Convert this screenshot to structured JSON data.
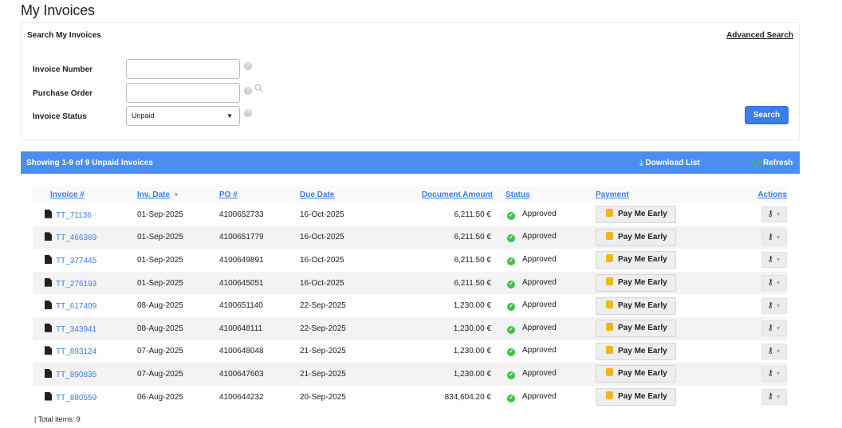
{
  "page": {
    "title": "My Invoices"
  },
  "search": {
    "heading": "Search My Invoices",
    "advanced_link": "Advanced Search",
    "invoice_number_label": "Invoice Number",
    "invoice_number_value": "",
    "purchase_order_label": "Purchase Order",
    "purchase_order_value": "",
    "status_label": "Invoice Status",
    "status_value": "Unpaid",
    "search_button": "Search"
  },
  "results": {
    "summary": "Showing 1-9 of 9 Unpaid Invoices",
    "download": "Download List",
    "refresh": "Refresh",
    "accent_color": "#4a8ef2"
  },
  "table": {
    "columns": [
      "Invoice #",
      "Inv. Date",
      "PO #",
      "Due Date",
      "Document Amount",
      "Status",
      "Payment",
      "Actions"
    ],
    "pay_label": "Pay Me Early",
    "rows": [
      {
        "invoice": "TT_71136",
        "inv_date": "01-Sep-2025",
        "po": "4100652733",
        "due": "16-Oct-2025",
        "amount": "6,211.50 €",
        "status": "Approved"
      },
      {
        "invoice": "TT_466369",
        "inv_date": "01-Sep-2025",
        "po": "4100651779",
        "due": "16-Oct-2025",
        "amount": "6,211.50 €",
        "status": "Approved"
      },
      {
        "invoice": "TT_377445",
        "inv_date": "01-Sep-2025",
        "po": "4100649891",
        "due": "16-Oct-2025",
        "amount": "6,211.50 €",
        "status": "Approved"
      },
      {
        "invoice": "TT_276193",
        "inv_date": "01-Sep-2025",
        "po": "4100645051",
        "due": "16-Oct-2025",
        "amount": "6,211.50 €",
        "status": "Approved"
      },
      {
        "invoice": "TT_617409",
        "inv_date": "08-Aug-2025",
        "po": "4100651140",
        "due": "22-Sep-2025",
        "amount": "1,230.00 €",
        "status": "Approved"
      },
      {
        "invoice": "TT_343941",
        "inv_date": "08-Aug-2025",
        "po": "4100648111",
        "due": "22-Sep-2025",
        "amount": "1,230.00 €",
        "status": "Approved"
      },
      {
        "invoice": "TT_893124",
        "inv_date": "07-Aug-2025",
        "po": "4100648048",
        "due": "21-Sep-2025",
        "amount": "1,230.00 €",
        "status": "Approved"
      },
      {
        "invoice": "TT_890835",
        "inv_date": "07-Aug-2025",
        "po": "4100647603",
        "due": "21-Sep-2025",
        "amount": "1,230.00 €",
        "status": "Approved"
      },
      {
        "invoice": "TT_880559",
        "inv_date": "06-Aug-2025",
        "po": "4100644232",
        "due": "20-Sep-2025",
        "amount": "834,604.20 €",
        "status": "Approved"
      }
    ]
  },
  "footer": {
    "total": "| Total items: 9"
  }
}
